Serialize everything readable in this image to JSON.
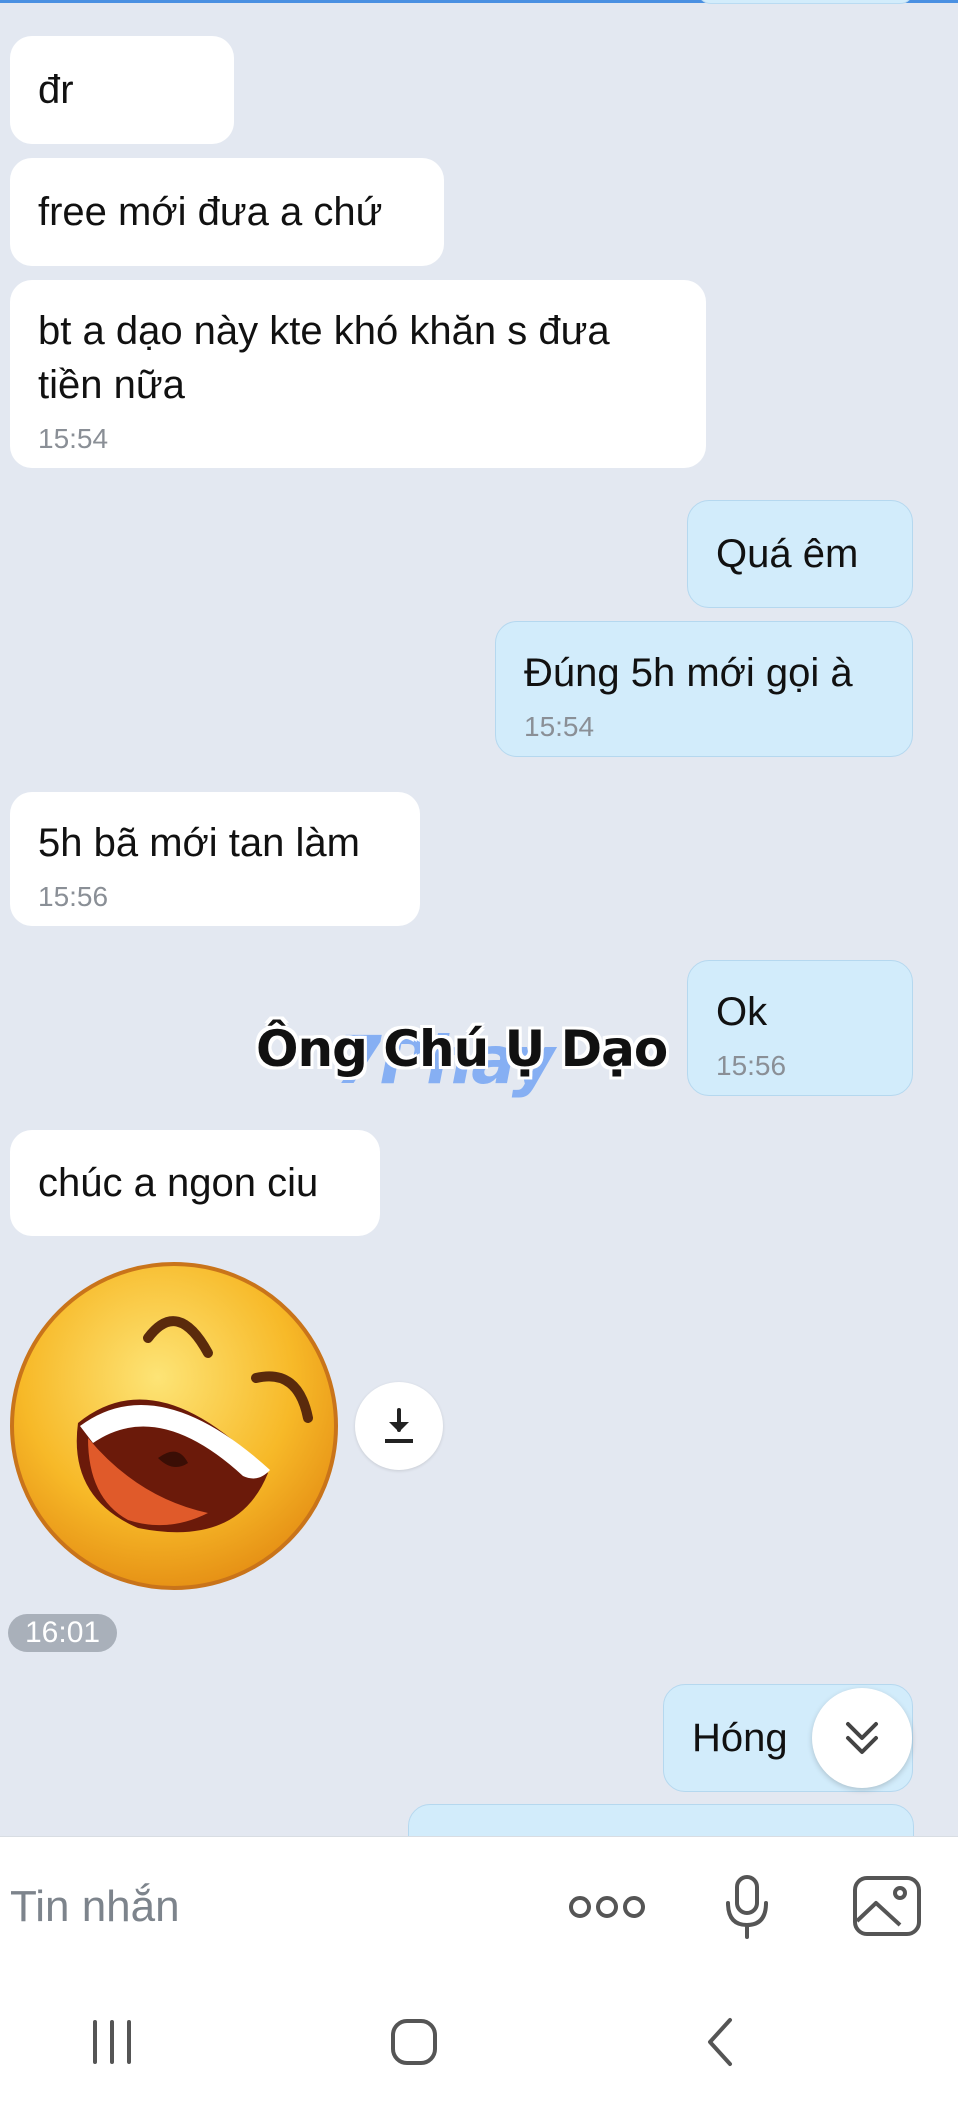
{
  "messages": [
    {
      "side": "in",
      "text": "đr",
      "time": ""
    },
    {
      "side": "in",
      "text": "free mới đưa a chứ",
      "time": ""
    },
    {
      "side": "in",
      "text": "bt a dạo này kte khó khăn s đưa\ntiền nữa",
      "time": "15:54"
    },
    {
      "side": "out",
      "text": "Quá êm",
      "time": ""
    },
    {
      "side": "out",
      "text": "Đúng 5h mới gọi à",
      "time": "15:54"
    },
    {
      "side": "in",
      "text": "5h bã mới tan làm",
      "time": "15:56"
    },
    {
      "side": "out",
      "text": "Ok",
      "time": "15:56"
    },
    {
      "side": "in",
      "text": "chúc a ngon ciu",
      "time": ""
    },
    {
      "side": "out",
      "text": "Hóng",
      "time": ""
    }
  ],
  "sticker": {
    "icon": "laughing-face-sticker",
    "time": "16:01"
  },
  "watermark": {
    "text": "Ông Chú Ụ Dạo",
    "brand_text": "7Phay"
  },
  "input": {
    "placeholder": "Tin nhắn"
  },
  "toolbar_icons": [
    "more-options-icon",
    "microphone-icon",
    "image-icon"
  ],
  "nav_icons": [
    "recent-apps-icon",
    "home-icon",
    "back-icon"
  ],
  "colors": {
    "incoming": "#ffffff",
    "outgoing": "#d2ecfb",
    "background": "#e3e8f1",
    "accent": "#4a90e2"
  }
}
